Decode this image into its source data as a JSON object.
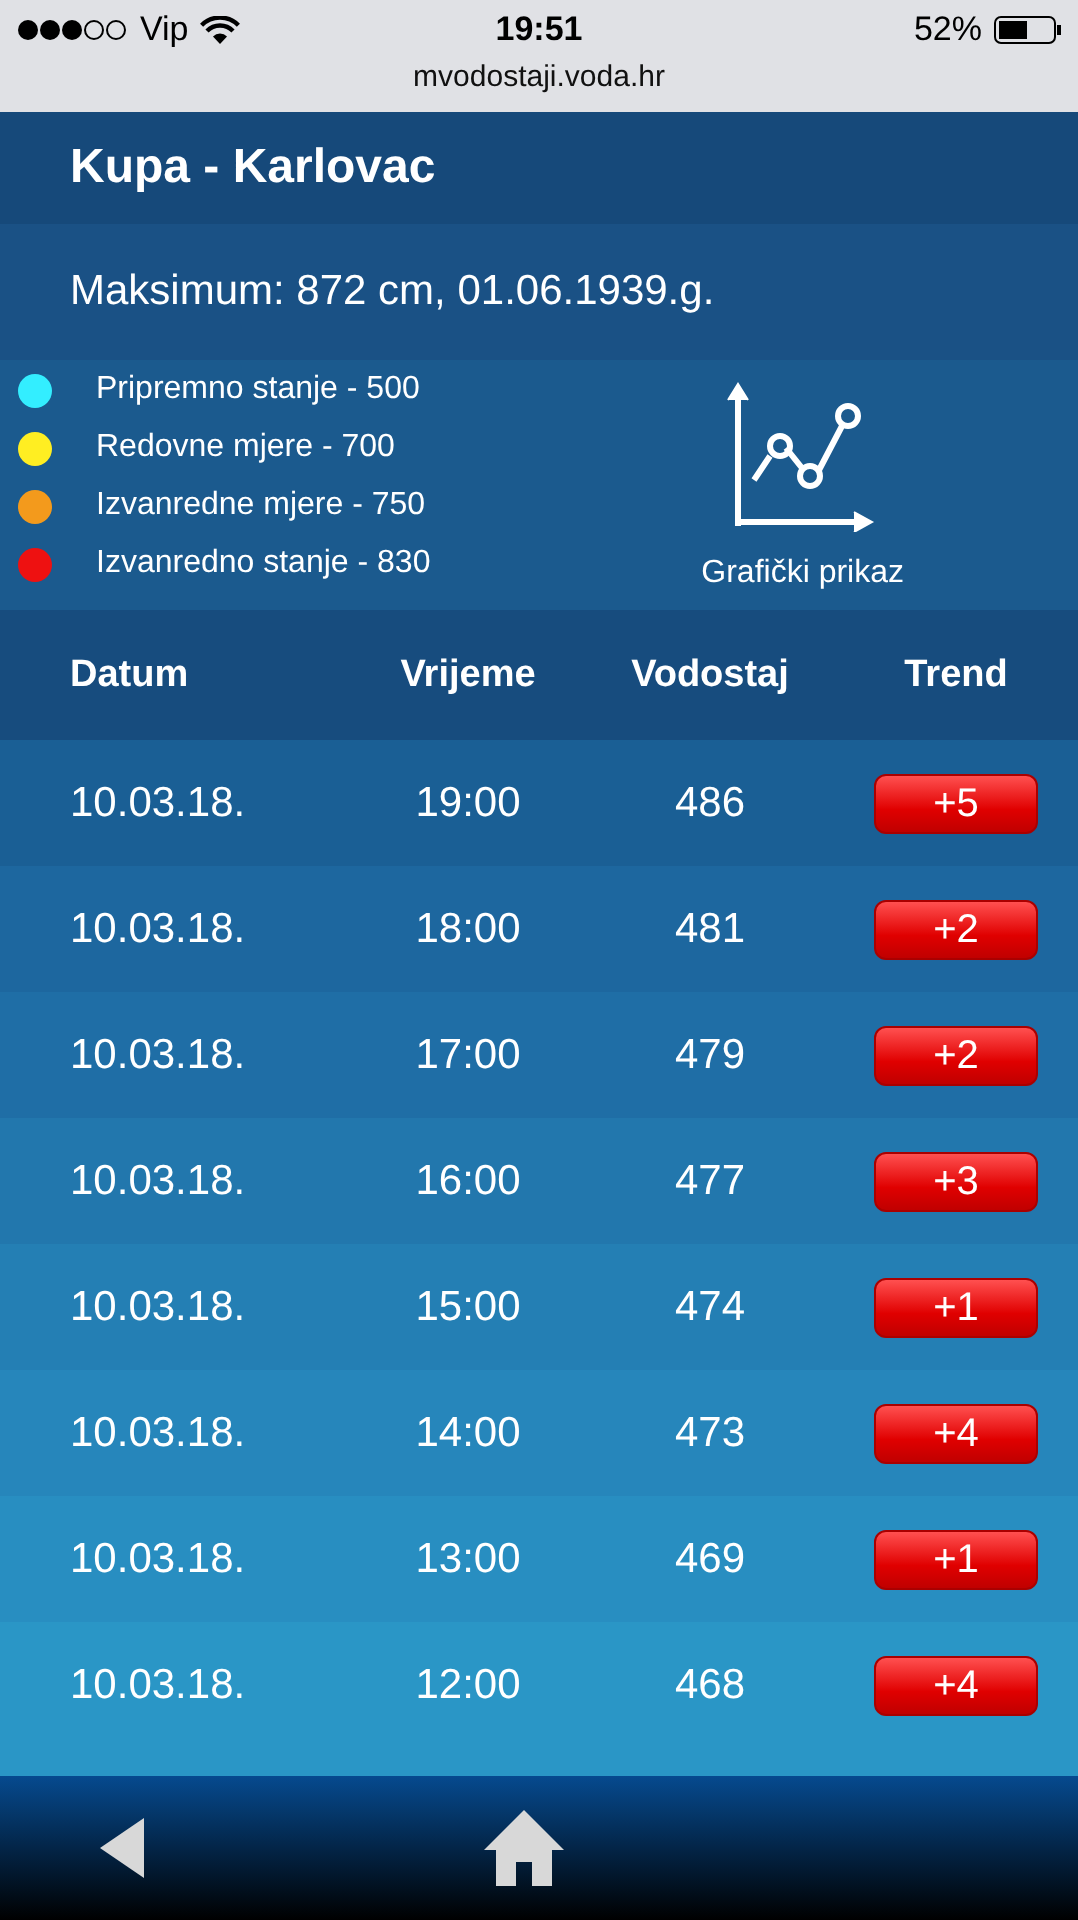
{
  "status_bar": {
    "carrier": "Vip",
    "time": "19:51",
    "battery": "52%"
  },
  "url_bar": {
    "url": "mvodostaji.voda.hr"
  },
  "station": {
    "title": "Kupa - Karlovac",
    "maximum": "Maksimum: 872 cm, 01.06.1939.g."
  },
  "legend": [
    {
      "label": "Pripremno stanje - 500",
      "color": "#33eeff"
    },
    {
      "label": "Redovne mjere - 700",
      "color": "#ffee22"
    },
    {
      "label": "Izvanredne mjere - 750",
      "color": "#f39a1c"
    },
    {
      "label": "Izvanredno stanje - 830",
      "color": "#ee1111"
    }
  ],
  "chart_link": {
    "label": "Grafički prikaz"
  },
  "table": {
    "columns": [
      "Datum",
      "Vrijeme",
      "Vodostaj",
      "Trend"
    ],
    "rows": [
      {
        "date": "10.03.18.",
        "time": "19:00",
        "level": "486",
        "trend": "+5"
      },
      {
        "date": "10.03.18.",
        "time": "18:00",
        "level": "481",
        "trend": "+2"
      },
      {
        "date": "10.03.18.",
        "time": "17:00",
        "level": "479",
        "trend": "+2"
      },
      {
        "date": "10.03.18.",
        "time": "16:00",
        "level": "477",
        "trend": "+3"
      },
      {
        "date": "10.03.18.",
        "time": "15:00",
        "level": "474",
        "trend": "+1"
      },
      {
        "date": "10.03.18.",
        "time": "14:00",
        "level": "473",
        "trend": "+4"
      },
      {
        "date": "10.03.18.",
        "time": "13:00",
        "level": "469",
        "trend": "+1"
      },
      {
        "date": "10.03.18.",
        "time": "12:00",
        "level": "468",
        "trend": "+4"
      }
    ]
  }
}
